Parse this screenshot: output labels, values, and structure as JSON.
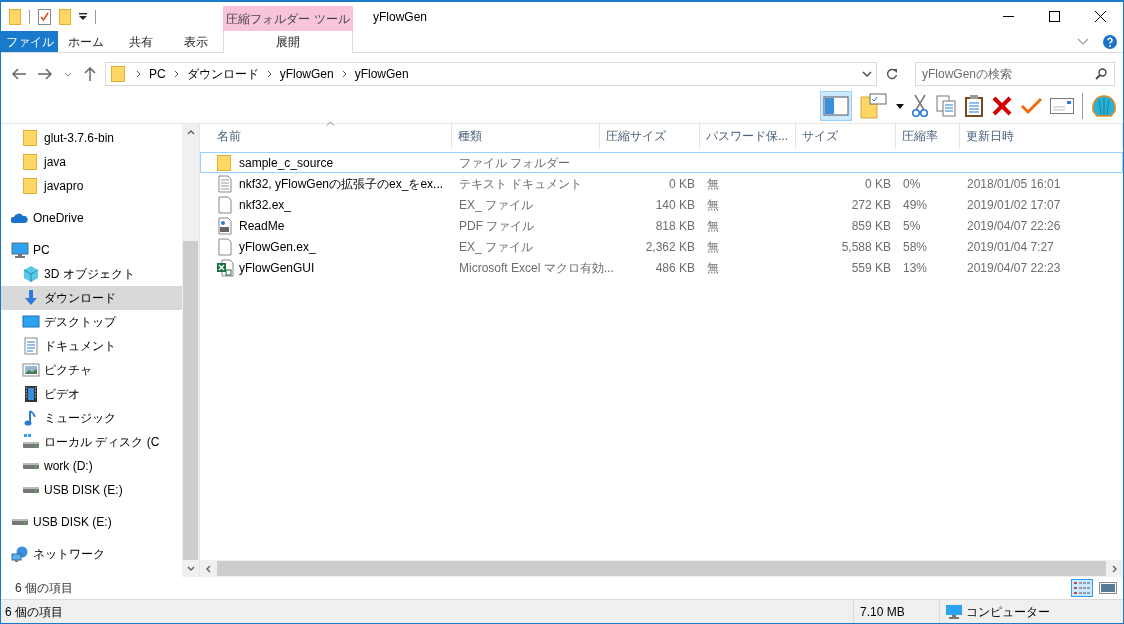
{
  "title_bar": {
    "context_tab": "圧縮フォルダー ツール",
    "title": "yFlowGen"
  },
  "ribbon_tabs": [
    {
      "label": "ファイル",
      "kind": "file"
    },
    {
      "label": "ホーム",
      "kind": "normal"
    },
    {
      "label": "共有",
      "kind": "normal"
    },
    {
      "label": "表示",
      "kind": "normal"
    },
    {
      "label": "展開",
      "kind": "context"
    }
  ],
  "address": {
    "breadcrumbs": [
      "PC",
      "ダウンロード",
      "yFlowGen",
      "yFlowGen"
    ],
    "search_placeholder": "yFlowGenの検索"
  },
  "toolbar": {
    "preview_pane_on": true
  },
  "nav": [
    {
      "children": [
        {
          "label": "glut-3.7.6-bin",
          "kind": "folder",
          "selected": false
        },
        {
          "label": "java",
          "kind": "folder",
          "selected": false
        },
        {
          "label": "javapro",
          "kind": "folder",
          "selected": false
        }
      ]
    },
    {
      "label": "OneDrive",
      "kind": "cloud",
      "selected": false
    },
    {
      "label": "PC",
      "kind": "pc",
      "selected": false,
      "children": [
        {
          "label": "3D オブジェクト",
          "kind": "cube",
          "selected": false
        },
        {
          "label": "ダウンロード",
          "kind": "download",
          "selected": true
        },
        {
          "label": "デスクトップ",
          "kind": "desktop",
          "selected": false
        },
        {
          "label": "ドキュメント",
          "kind": "document",
          "selected": false
        },
        {
          "label": "ピクチャ",
          "kind": "picture",
          "selected": false
        },
        {
          "label": "ビデオ",
          "kind": "video",
          "selected": false
        },
        {
          "label": "ミュージック",
          "kind": "music",
          "selected": false
        },
        {
          "label": "ローカル ディスク (C",
          "kind": "system-drive",
          "selected": false
        },
        {
          "label": "work (D:)",
          "kind": "drive",
          "selected": false
        },
        {
          "label": "USB DISK (E:)",
          "kind": "drive",
          "selected": false
        }
      ]
    },
    {
      "label": "USB DISK (E:)",
      "kind": "drive",
      "selected": false
    },
    {
      "label": "ネットワーク",
      "kind": "network",
      "selected": false
    }
  ],
  "columns": [
    {
      "label": "名前",
      "sorted": true
    },
    {
      "label": "種類",
      "sorted": false
    },
    {
      "label": "圧縮サイズ",
      "sorted": false
    },
    {
      "label": "パスワード保...",
      "sorted": false
    },
    {
      "label": "サイズ",
      "sorted": false
    },
    {
      "label": "圧縮率",
      "sorted": false
    },
    {
      "label": "更新日時",
      "sorted": false
    }
  ],
  "rows": [
    {
      "kind": "folder",
      "selected": true,
      "cells": [
        "sample_c_source",
        "ファイル フォルダー",
        "",
        "",
        "",
        "",
        ""
      ]
    },
    {
      "kind": "text",
      "selected": false,
      "cells": [
        "nkf32, yFlowGenの拡張子のex_をex...",
        "テキスト ドキュメント",
        "0 KB",
        "無",
        "0 KB",
        "0%",
        "2018/01/05 16:01"
      ]
    },
    {
      "kind": "file",
      "selected": false,
      "cells": [
        "nkf32.ex_",
        "EX_ ファイル",
        "140 KB",
        "無",
        "272 KB",
        "49%",
        "2019/01/02 17:07"
      ]
    },
    {
      "kind": "pdf",
      "selected": false,
      "cells": [
        "ReadMe",
        "PDF ファイル",
        "818 KB",
        "無",
        "859 KB",
        "5%",
        "2019/04/07 22:26"
      ]
    },
    {
      "kind": "file",
      "selected": false,
      "cells": [
        "yFlowGen.ex_",
        "EX_ ファイル",
        "2,362 KB",
        "無",
        "5,588 KB",
        "58%",
        "2019/01/04 7:27"
      ]
    },
    {
      "kind": "excel",
      "selected": false,
      "cells": [
        "yFlowGenGUI",
        "Microsoft Excel マクロ有効...",
        "486 KB",
        "無",
        "559 KB",
        "13%",
        "2019/04/07 22:23"
      ]
    }
  ],
  "pane_footer": {
    "item_count": "6 個の項目",
    "views": [
      {
        "kind": "details",
        "selected": true
      },
      {
        "kind": "large-icons",
        "selected": false
      }
    ]
  },
  "status_bar": {
    "item_count": "6 個の項目",
    "size": "7.10 MB",
    "location": "コンピューター"
  }
}
